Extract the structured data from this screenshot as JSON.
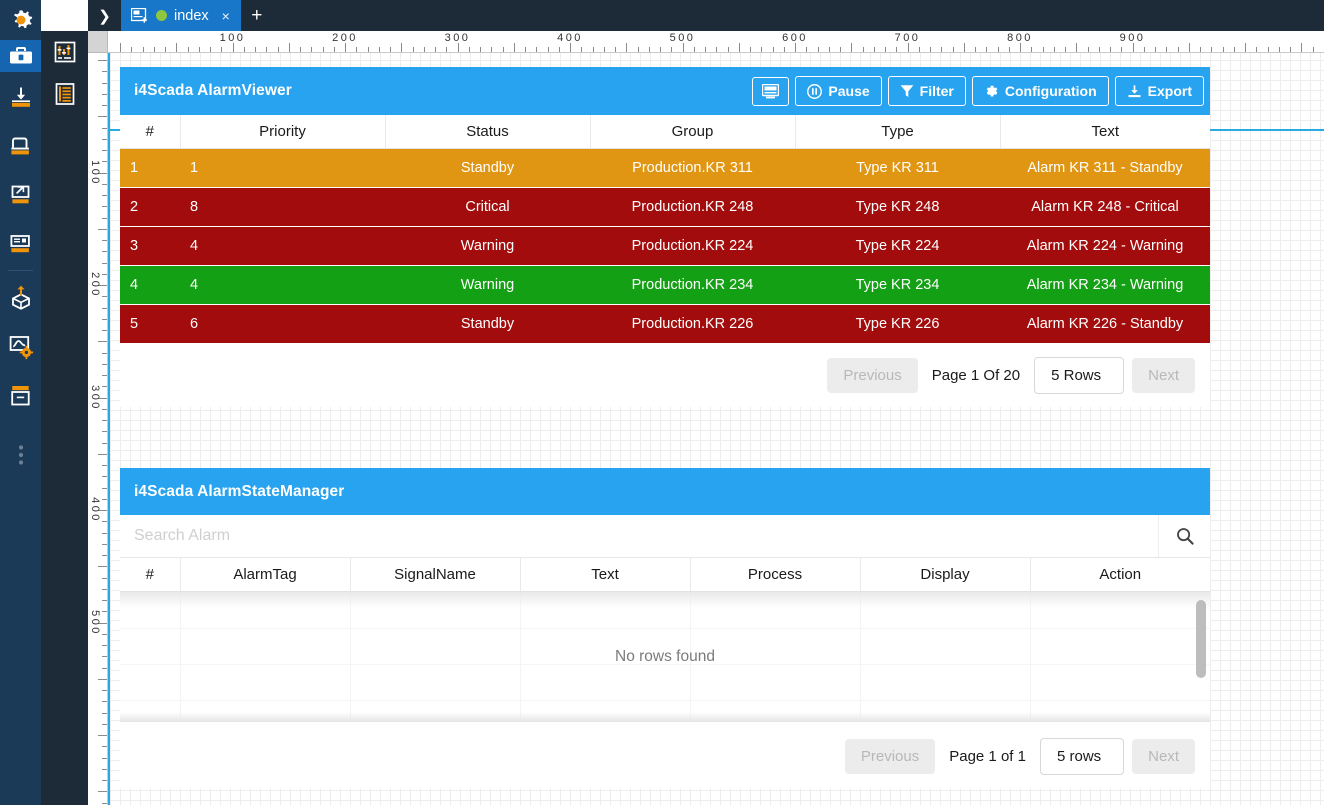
{
  "tabbar": {
    "expand_label": "❯",
    "tab_label": "index",
    "close_label": "×",
    "add_label": "+"
  },
  "rails": {
    "primary": [
      {
        "name": "settings-gear-icon",
        "label": "Settings"
      },
      {
        "name": "toolbox-icon",
        "label": "Toolbox"
      },
      {
        "name": "import-icon",
        "label": "Import"
      },
      {
        "name": "server-icon",
        "label": "Server"
      },
      {
        "name": "export-external-icon",
        "label": "External"
      },
      {
        "name": "documents-icon",
        "label": "Documents"
      },
      {
        "name": "deploy-box-icon",
        "label": "Deploy"
      },
      {
        "name": "trend-config-icon",
        "label": "Trend Settings"
      },
      {
        "name": "archive-icon",
        "label": "Archive"
      },
      {
        "name": "more-dots-icon",
        "label": "More"
      }
    ],
    "secondary": [
      {
        "name": "properties-panel-icon",
        "label": "Properties"
      },
      {
        "name": "list-panel-icon",
        "label": "List"
      }
    ]
  },
  "rulers": {
    "horizontal_labels": [
      "100",
      "200",
      "300",
      "400",
      "500",
      "600",
      "700",
      "800",
      "900"
    ],
    "vertical_labels": [
      "100",
      "200",
      "300",
      "400",
      "500"
    ]
  },
  "alarm_viewer": {
    "title": "i4Scada AlarmViewer",
    "buttons": [
      {
        "name": "monitor-button",
        "label": "",
        "icon": "monitor-icon"
      },
      {
        "name": "pause-button",
        "label": "Pause",
        "icon": "pause-icon"
      },
      {
        "name": "filter-button",
        "label": "Filter",
        "icon": "funnel-icon"
      },
      {
        "name": "configuration-button",
        "label": "Configuration",
        "icon": "gear-icon"
      },
      {
        "name": "export-button",
        "label": "Export",
        "icon": "download-icon"
      }
    ],
    "columns": [
      "#",
      "Priority",
      "Status",
      "Group",
      "Type",
      "Text"
    ],
    "rows": [
      {
        "num": "1",
        "priority": "1",
        "status": "Standby",
        "group": "Production.KR 311",
        "type": "Type KR 311",
        "text": "Alarm KR 311 - Standby",
        "color": "orange"
      },
      {
        "num": "2",
        "priority": "8",
        "status": "Critical",
        "group": "Production.KR 248",
        "type": "Type KR 248",
        "text": "Alarm KR 248 - Critical",
        "color": "red"
      },
      {
        "num": "3",
        "priority": "4",
        "status": "Warning",
        "group": "Production.KR 224",
        "type": "Type KR 224",
        "text": "Alarm KR 224 - Warning",
        "color": "red"
      },
      {
        "num": "4",
        "priority": "4",
        "status": "Warning",
        "group": "Production.KR 234",
        "type": "Type KR 234",
        "text": "Alarm KR 234 - Warning",
        "color": "green"
      },
      {
        "num": "5",
        "priority": "6",
        "status": "Standby",
        "group": "Production.KR 226",
        "type": "Type KR 226",
        "text": "Alarm KR 226 - Standby",
        "color": "red"
      }
    ],
    "pager": {
      "previous": "Previous",
      "page_label": "Page 1 Of 20",
      "rows_select": "5 Rows",
      "next": "Next"
    }
  },
  "alarm_state_manager": {
    "title": "i4Scada AlarmStateManager",
    "search_placeholder": "Search Alarm",
    "search_value": "",
    "columns": [
      "#",
      "AlarmTag",
      "SignalName",
      "Text",
      "Process",
      "Display",
      "Action"
    ],
    "empty_message": "No rows found",
    "pager": {
      "previous": "Previous",
      "page_label": "Page 1 of 1",
      "rows_select": "5 rows",
      "next": "Next"
    }
  },
  "colors": {
    "brand_blue": "#27a3f0",
    "tab_blue": "#1877c8",
    "rail_navy": "#1b3a57",
    "rail_dark": "#1d2b39",
    "accent_orange": "#f0940a",
    "row_orange": "#e09612",
    "row_red": "#a20c0c",
    "row_green": "#14a014",
    "guide_cyan": "#29abe2"
  }
}
